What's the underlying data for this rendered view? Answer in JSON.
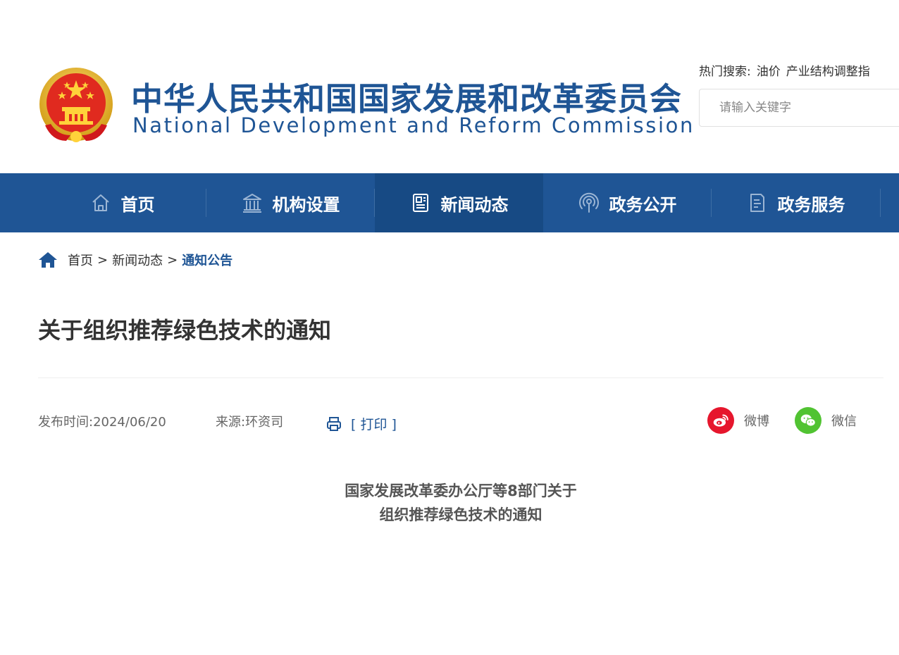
{
  "header": {
    "site_title_cn": "中华人民共和国国家发展和改革委员会",
    "site_title_en": "National Development and Reform Commission",
    "hot_search_label": "热门搜索:",
    "hot_search_words": [
      "油价",
      "产业结构调整指"
    ],
    "search_placeholder": "请输入关键字"
  },
  "nav": {
    "items": [
      {
        "label": "首页",
        "icon": "home-icon"
      },
      {
        "label": "机构设置",
        "icon": "institution-icon"
      },
      {
        "label": "新闻动态",
        "icon": "news-icon",
        "active": true
      },
      {
        "label": "政务公开",
        "icon": "broadcast-icon"
      },
      {
        "label": "政务服务",
        "icon": "document-icon"
      }
    ],
    "background": "#1f5595",
    "active_background": "#174a84"
  },
  "breadcrumb": {
    "items": [
      "首页",
      "新闻动态"
    ],
    "separator": ">",
    "current": "通知公告"
  },
  "article": {
    "title": "关于组织推荐绿色技术的通知",
    "publish_label": "发布时间:",
    "publish_date": "2024/06/20",
    "source_label": "来源:",
    "source": "环资司",
    "print_label": "[ 打印 ]",
    "share": {
      "weibo_label": "微博",
      "wechat_label": "微信"
    },
    "doc_heading_line1": "国家发展改革委办公厅等8部门关于",
    "doc_heading_line2": "组织推荐绿色技术的通知"
  },
  "colors": {
    "brand_blue": "#1f5595",
    "weibo_red": "#e6162d",
    "wechat_green": "#51c332"
  }
}
